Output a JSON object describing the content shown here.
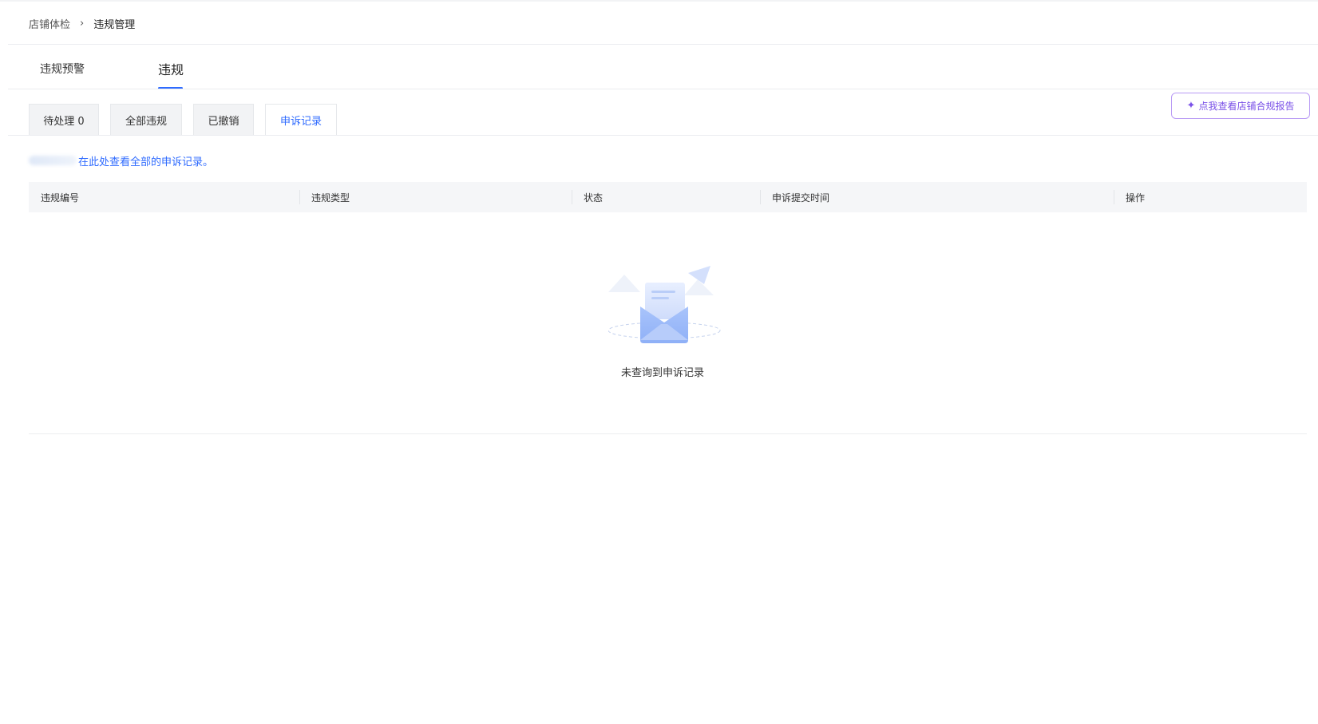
{
  "breadcrumb": {
    "root": "店铺体检",
    "separator": "›",
    "current": "违规管理"
  },
  "main_tabs": [
    {
      "label": "违规预警",
      "active": false
    },
    {
      "label": "违规",
      "active": true
    }
  ],
  "sub_tabs": [
    {
      "label": "待处理 0",
      "active": false
    },
    {
      "label": "全部违规",
      "active": false
    },
    {
      "label": "已撤销",
      "active": false
    },
    {
      "label": "申诉记录",
      "active": true
    }
  ],
  "report_button": {
    "label": "点我查看店铺合规报告",
    "icon": "sparkle-icon"
  },
  "hint": {
    "text": "在此处查看全部的申诉记录。"
  },
  "table": {
    "columns": [
      "违规编号",
      "违规类型",
      "状态",
      "申诉提交时间",
      "操作"
    ],
    "rows": []
  },
  "empty_state": {
    "text": "未查询到申诉记录",
    "icon": "empty-mail-icon"
  },
  "colors": {
    "accent": "#2f6bff",
    "report_accent": "#7b52e8",
    "header_bg": "#f5f6f8"
  }
}
